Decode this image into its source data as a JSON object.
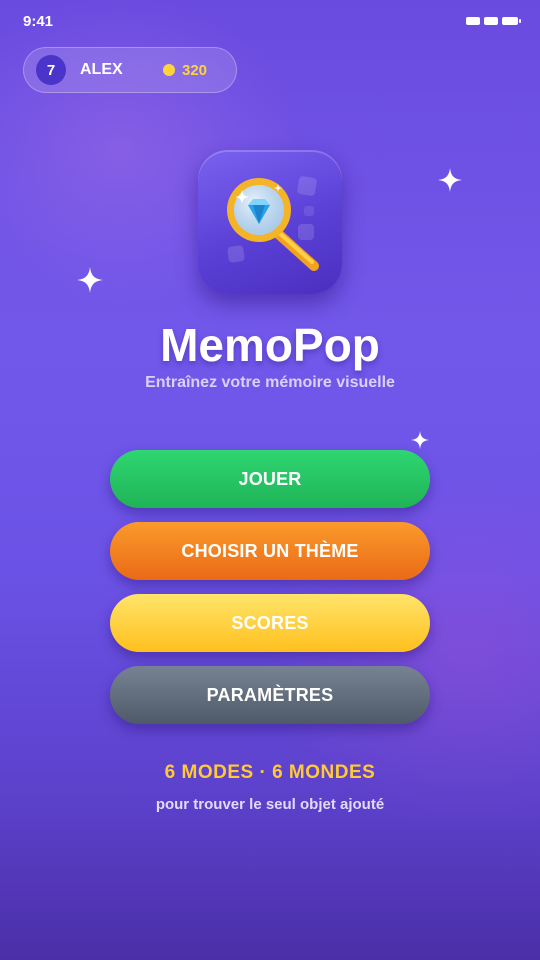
{
  "status_bar": {
    "time": "9:41"
  },
  "profile": {
    "level": "7",
    "name": "ALEX",
    "coins": "320"
  },
  "app": {
    "title": "MemoPop",
    "subtitle": "Entraînez votre mémoire visuelle",
    "icon": "magnifier-diamond-icon"
  },
  "menu": {
    "play_label": "JOUER",
    "theme_label": "CHOISIR UN THÈME",
    "scores_label": "SCORES",
    "settings_label": "PARAMÈTRES"
  },
  "footer": {
    "tagline": "6 MODES · 6 MONDES",
    "description": "pour trouver le seul objet ajouté"
  },
  "colors": {
    "background": "#6a4be0",
    "play": "#22c35f",
    "theme": "#f07a1e",
    "scores": "#ffd23a",
    "settings": "#5f6a79",
    "coin": "#ffd43a",
    "tagline": "#ffc93a"
  }
}
